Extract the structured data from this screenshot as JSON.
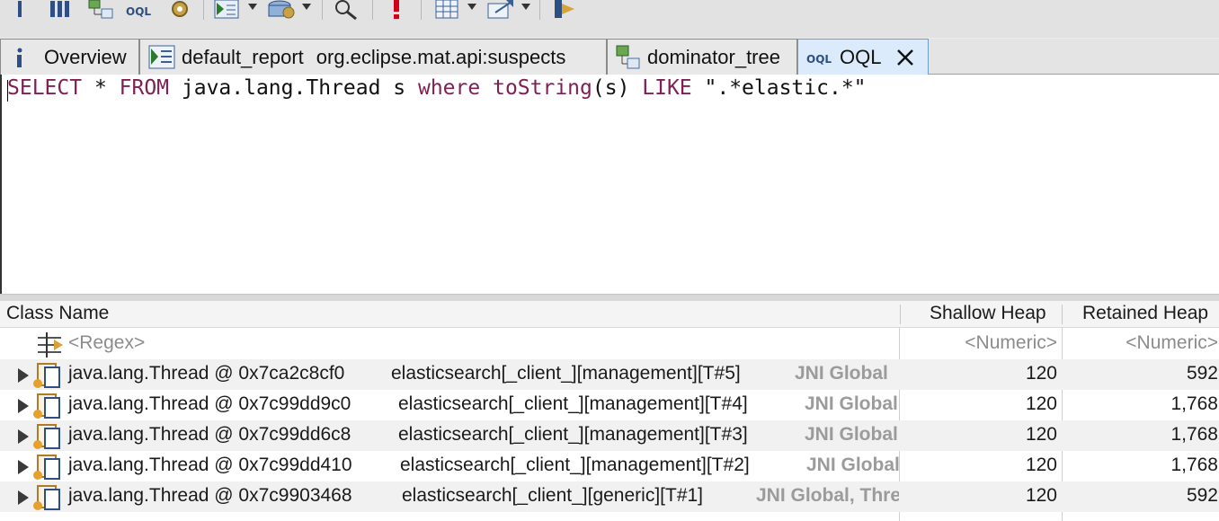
{
  "toolbar": {
    "items": [
      "info-icon",
      "histogram-icon",
      "dominator-tree-icon",
      "oql-icon",
      "gear-icon",
      "run-report-icon",
      "query-browser-icon",
      "search-icon",
      "alert-icon",
      "grid-icon",
      "export-icon",
      "pin-icon"
    ]
  },
  "tabs": [
    {
      "label": "Overview",
      "icon": "info-icon"
    },
    {
      "label": "default_report",
      "label2": "org.eclipse.mat.api:suspects",
      "icon": "report-icon"
    },
    {
      "label": "dominator_tree",
      "icon": "dominator-tree-icon"
    },
    {
      "label": "OQL",
      "icon": "oql-icon",
      "active": true
    }
  ],
  "editor": {
    "kw_select": "SELECT",
    "star": " * ",
    "kw_from": "FROM",
    "cls": " java.lang.Thread s ",
    "kw_where": "where",
    "sp": " ",
    "fn": "toString",
    "arg": "(s) ",
    "kw_like": "LIKE",
    "literal": " \".*elastic.*\""
  },
  "table": {
    "columns": {
      "class_name": "Class Name",
      "shallow": "Shallow Heap",
      "retained": "Retained Heap"
    },
    "filter": {
      "regex": "<Regex>",
      "numeric1": "<Numeric>",
      "numeric2": "<Numeric>"
    },
    "rows": [
      {
        "obj": "java.lang.Thread @ 0x7ca2c8cf0",
        "name": "elasticsearch[_client_][management][T#5]",
        "gc": "JNI Global",
        "shallow": "120",
        "retained": "592"
      },
      {
        "obj": "java.lang.Thread @ 0x7c99dd9c0",
        "name": "elasticsearch[_client_][management][T#4]",
        "gc": "JNI Global",
        "shallow": "120",
        "retained": "1,768"
      },
      {
        "obj": "java.lang.Thread @ 0x7c99dd6c8",
        "name": "elasticsearch[_client_][management][T#3]",
        "gc": "JNI Global",
        "shallow": "120",
        "retained": "1,768"
      },
      {
        "obj": "java.lang.Thread @ 0x7c99dd410",
        "name": "elasticsearch[_client_][management][T#2]",
        "gc": "JNI Global",
        "shallow": "120",
        "retained": "1,768"
      },
      {
        "obj": "java.lang.Thread @ 0x7c9903468",
        "name": "elasticsearch[_client_][generic][T#1]",
        "gc": "JNI Global, Thread",
        "shallow": "120",
        "retained": "592"
      }
    ]
  }
}
